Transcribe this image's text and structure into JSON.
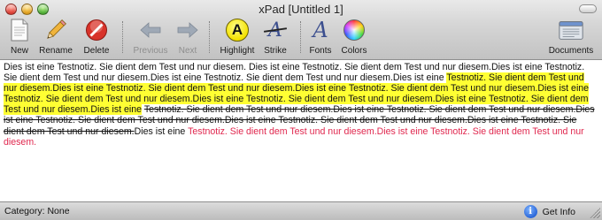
{
  "window": {
    "title": "xPad [Untitled 1]"
  },
  "toolbar": {
    "new": "New",
    "rename": "Rename",
    "delete": "Delete",
    "previous": "Previous",
    "next": "Next",
    "highlight": "Highlight",
    "highlight_glyph": "A",
    "strike": "Strike",
    "strike_glyph": "A",
    "fonts": "Fonts",
    "fonts_glyph": "A",
    "colors": "Colors",
    "documents": "Documents"
  },
  "content": {
    "segments": [
      {
        "style": "normal",
        "text": "Dies ist eine Testnotiz. Sie dient dem Test und nur diesem. Dies ist eine Testnotiz. Sie dient dem Test und nur diesem.Dies ist eine Testnotiz. Sie dient dem Test und nur diesem.Dies ist eine Testnotiz. Sie dient dem Test und nur diesem.Dies ist eine "
      },
      {
        "style": "highlight",
        "text": "Testnotiz. Sie dient dem Test und nur diesem.Dies ist eine Testnotiz. Sie dient dem Test und nur diesem.Dies ist eine Testnotiz. Sie dient dem Test und nur diesem.Dies ist eine Testnotiz. Sie dient dem Test und nur diesem.Dies ist eine Testnotiz. Sie dient dem Test und nur diesem.Dies ist eine Testnotiz. Sie dient dem Test und nur diesem.Dies ist eine"
      },
      {
        "style": "normal",
        "text": " "
      },
      {
        "style": "strike",
        "text": "Testnotiz. Sie dient dem Test und nur diesem.Dies ist eine Testnotiz. Sie dient dem Test und nur diesem.Dies ist eine Testnotiz. Sie dient dem Test und nur diesem.Dies ist eine Testnotiz. Sie dient dem Test und nur diesem.Dies ist eine Testnotiz. Sie dient dem Test und nur diesem."
      },
      {
        "style": "normal",
        "text": "Dies ist eine "
      },
      {
        "style": "red",
        "text": "Testnotiz. Sie dient dem Test und nur diesem.Dies ist eine Testnotiz. Sie dient dem Test und nur diesem."
      }
    ]
  },
  "status": {
    "category": "Category: None",
    "get_info": "Get Info",
    "info_glyph": "i"
  },
  "colors": {
    "highlight": "#ffff33",
    "red_text": "#e0284f",
    "delete_red": "#d8332a"
  }
}
